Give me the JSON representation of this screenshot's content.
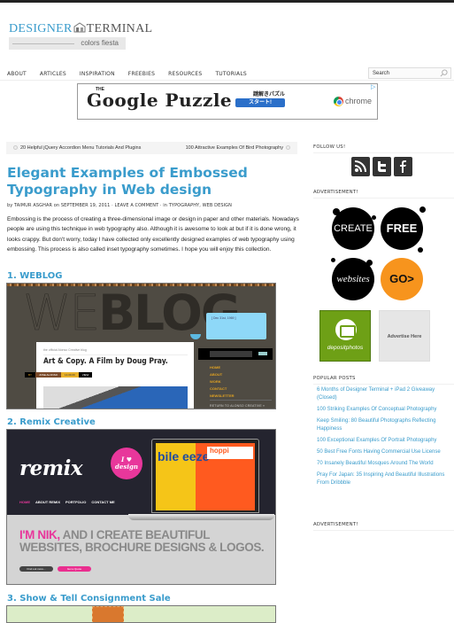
{
  "site": {
    "logo_main_first": "DESIGNER",
    "logo_main_second": "TERMINAL",
    "logo_tagline": "colors fiesta"
  },
  "nav": {
    "items": [
      {
        "label": "ABOUT"
      },
      {
        "label": "ARTICLES"
      },
      {
        "label": "INSPIRATION"
      },
      {
        "label": "FREEBIES"
      },
      {
        "label": "RESOURCES"
      },
      {
        "label": "TUTORIALS"
      }
    ]
  },
  "search": {
    "placeholder": "Search"
  },
  "top_ad": {
    "the": "THE",
    "title": "Google Puzzle",
    "japanese_text": "謎解きパズル",
    "start_button": "スタート!",
    "brand": "chrome",
    "adchoices_icon": "adchoices-icon"
  },
  "post_nav": {
    "prev": "20 Helpful jQuery Accordion Menu Tutorials And Plugins",
    "next": "100 Attractive Examples Of Bird Photography"
  },
  "article": {
    "title": "Elegant Examples of Embossed Typography in Web design",
    "meta": "by TAIMUR ASGHAR on SEPTEMBER 19, 2011 · LEAVE A COMMENT · in TYPOGRAPHY, WEB DESIGN",
    "intro": "Embossing is the process of creating a three-dimensional image or design in paper and other materials. Nowadays people are using this technique in web typography also. Although it is awesome to look at but if it is done wrong, it looks crappy. But don't worry, today I have collected only excellently designed examples of web typography using embossing. This process is also called inset typography sometimes. I hope you will enjoy this collection.",
    "sections": [
      {
        "heading": "1. WEBLOG",
        "screenshot": {
          "we": "WE",
          "blog": "BLOG",
          "bubble_text": "[ Dec 31st, 1969 ]",
          "tagline": "the official Alonso Creative blog",
          "post_title": "Art & Copy. A Film by Doug Pray.",
          "tags": [
            "BY",
            "JOSE ALONSO",
            "14.09.09",
            "VIEW"
          ],
          "menu": [
            "HOME",
            "ABOUT",
            "WORK",
            "CONTACT",
            "NEWSLETTER"
          ],
          "return_link": "RETURN TO ALONSO CREATIVE »"
        }
      },
      {
        "heading": "2. Remix Creative",
        "screenshot": {
          "logo": "remix",
          "sticker": "I ♥ design",
          "nav": [
            "HOME",
            "ABOUT REMIX",
            "PORTFOLIO",
            "CONTACT ME"
          ],
          "screen_text_left": "bile eeze",
          "screen_text_right": "hoppi",
          "headline_pink": "I'M NIK,",
          "headline_line1_rest": " AND I CREATE BEAUTIFUL",
          "headline_line2": "WEBSITES, BROCHURE DESIGNS & LOGOS.",
          "button_more": "Find out more...",
          "button_quote": "Get a Quote"
        }
      },
      {
        "heading": "3. Show & Tell Consignment Sale"
      }
    ]
  },
  "sidebar": {
    "follow_heading": "FOLLOW US!",
    "social": [
      {
        "name": "rss-icon"
      },
      {
        "name": "twitter-icon"
      },
      {
        "name": "facebook-icon"
      }
    ],
    "ad_heading": "ADVERTISEMENT!",
    "circles_ad": {
      "create": "CREATE",
      "free": "FREE",
      "websites": "websites",
      "go": "GO>"
    },
    "depositphotos_label": "depositphotos",
    "advertise_here": "Advertise Here",
    "popular_heading": "POPULAR POSTS",
    "popular_posts": [
      "6 Months of Designer Terminal + iPad 2 Giveaway (Closed)",
      "100 Striking Examples Of Conceptual Photography",
      "Keep Smiling: 80 Beautiful Photographs Reflecting Happiness",
      "100 Exceptional Examples Of Portrait Photography",
      "50 Best Free Fonts Having Commercial Use License",
      "70 Insanely Beautiful Mosques Around The World",
      "Pray For Japan: 35 Inspiring And Beautiful Illustrations From Dribbble"
    ],
    "ad_heading_2": "ADVERTISEMENT!"
  },
  "colors": {
    "accent": "#3a9ccc",
    "remix_pink": "#e8379b",
    "go_orange": "#f7941d",
    "deposit_green": "#6ea016"
  }
}
